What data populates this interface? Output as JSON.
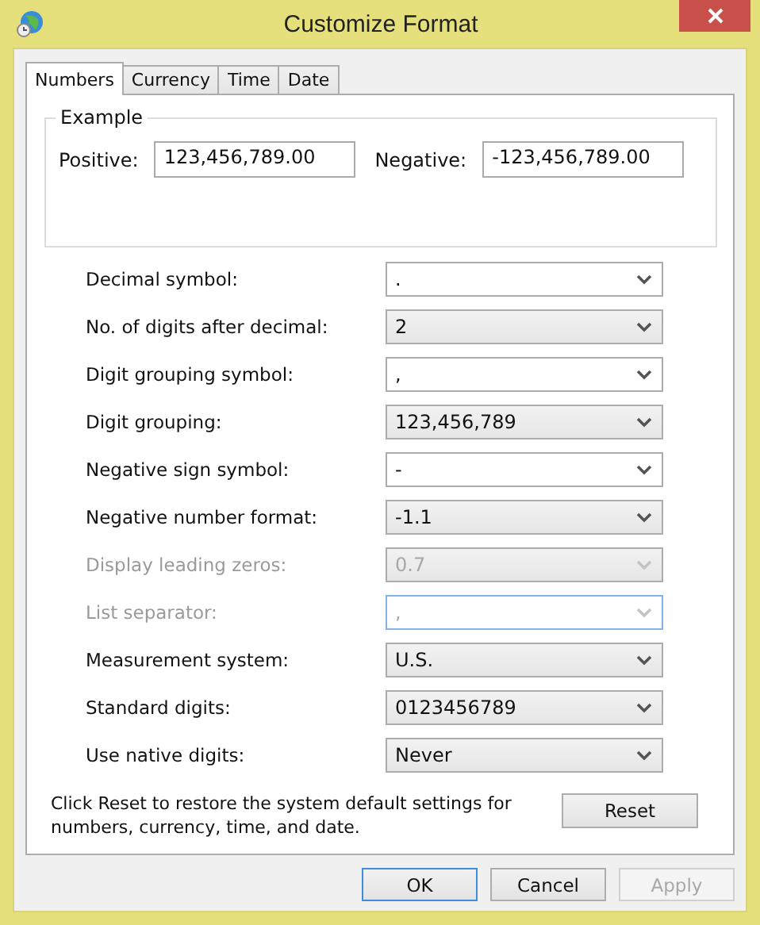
{
  "window": {
    "title": "Customize Format"
  },
  "tabs": [
    {
      "label": "Numbers",
      "selected": true
    },
    {
      "label": "Currency",
      "selected": false
    },
    {
      "label": "Time",
      "selected": false
    },
    {
      "label": "Date",
      "selected": false
    }
  ],
  "example": {
    "title": "Example",
    "positive_label": "Positive:",
    "positive_value": "123,456,789.00",
    "negative_label": "Negative:",
    "negative_value": "-123,456,789.00"
  },
  "settings": [
    {
      "label": "Decimal symbol:",
      "value": ".",
      "kind": "editable",
      "disabled": false,
      "focused": false
    },
    {
      "label": "No. of digits after decimal:",
      "value": "2",
      "kind": "list",
      "disabled": false,
      "focused": false
    },
    {
      "label": "Digit grouping symbol:",
      "value": ",",
      "kind": "editable",
      "disabled": false,
      "focused": false
    },
    {
      "label": "Digit grouping:",
      "value": "123,456,789",
      "kind": "list",
      "disabled": false,
      "focused": false
    },
    {
      "label": "Negative sign symbol:",
      "value": "-",
      "kind": "editable",
      "disabled": false,
      "focused": false
    },
    {
      "label": "Negative number format:",
      "value": "-1.1",
      "kind": "list",
      "disabled": false,
      "focused": false
    },
    {
      "label": "Display leading zeros:",
      "value": "0.7",
      "kind": "list",
      "disabled": true,
      "focused": false
    },
    {
      "label": "List separator:",
      "value": ",",
      "kind": "editable",
      "disabled": true,
      "focused": true
    },
    {
      "label": "Measurement system:",
      "value": "U.S.",
      "kind": "list",
      "disabled": false,
      "focused": false
    },
    {
      "label": "Standard digits:",
      "value": "0123456789",
      "kind": "list",
      "disabled": false,
      "focused": false
    },
    {
      "label": "Use native digits:",
      "value": "Never",
      "kind": "list",
      "disabled": false,
      "focused": false
    }
  ],
  "reset_note": "Click Reset to restore the system default settings for numbers, currency, time, and date.",
  "reset_button": "Reset",
  "buttons": [
    {
      "label": "OK",
      "default": true,
      "disabled": false
    },
    {
      "label": "Cancel",
      "default": false,
      "disabled": false
    },
    {
      "label": "Apply",
      "default": false,
      "disabled": true
    }
  ]
}
